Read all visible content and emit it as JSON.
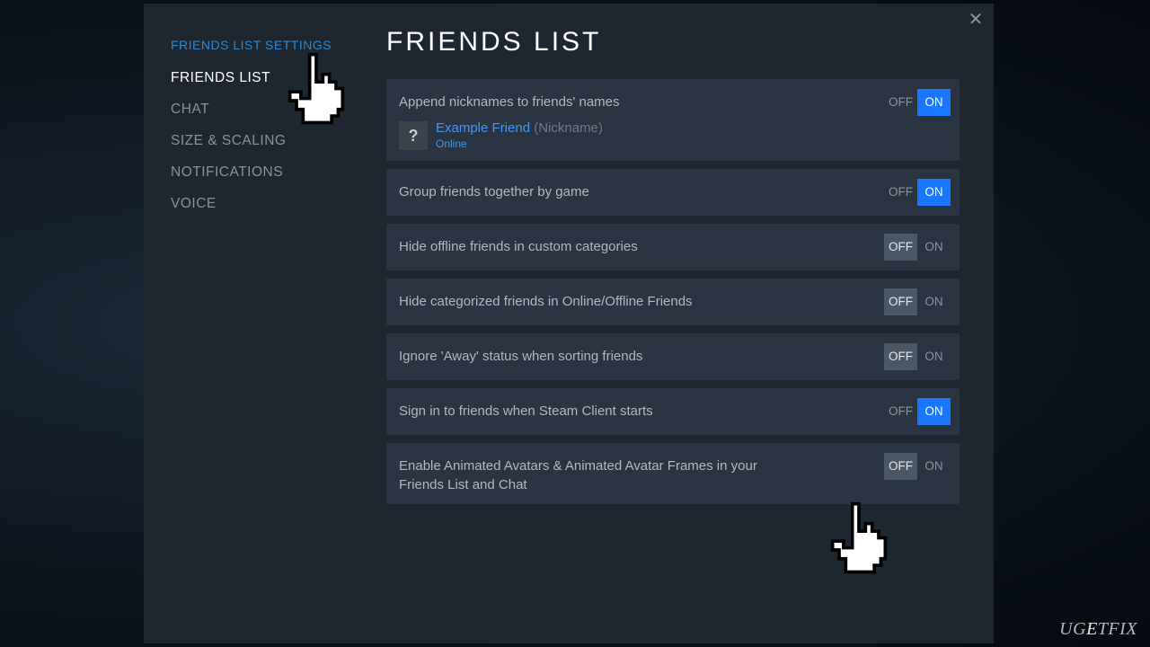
{
  "sidebar": {
    "header": "FRIENDS LIST SETTINGS",
    "items": [
      {
        "label": "FRIENDS LIST",
        "active": true
      },
      {
        "label": "CHAT",
        "active": false
      },
      {
        "label": "SIZE & SCALING",
        "active": false
      },
      {
        "label": "NOTIFICATIONS",
        "active": false
      },
      {
        "label": "VOICE",
        "active": false
      }
    ]
  },
  "main": {
    "title": "FRIENDS LIST",
    "off_label": "OFF",
    "on_label": "ON",
    "settings": [
      {
        "label": "Append nicknames to friends' names",
        "value": "on",
        "has_example": true
      },
      {
        "label": "Group friends together by game",
        "value": "on"
      },
      {
        "label": "Hide offline friends in custom categories",
        "value": "off"
      },
      {
        "label": "Hide categorized friends in Online/Offline Friends",
        "value": "off"
      },
      {
        "label": "Ignore 'Away' status when sorting friends",
        "value": "off"
      },
      {
        "label": "Sign in to friends when Steam Client starts",
        "value": "on"
      },
      {
        "label": "Enable Animated Avatars & Animated Avatar Frames in your Friends List and Chat",
        "value": "off"
      }
    ],
    "example": {
      "avatar_glyph": "?",
      "name": "Example Friend",
      "nickname": "(Nickname)",
      "status": "Online"
    }
  },
  "watermark": {
    "pre": "UG",
    "hi": "E",
    "post": "TFIX"
  }
}
